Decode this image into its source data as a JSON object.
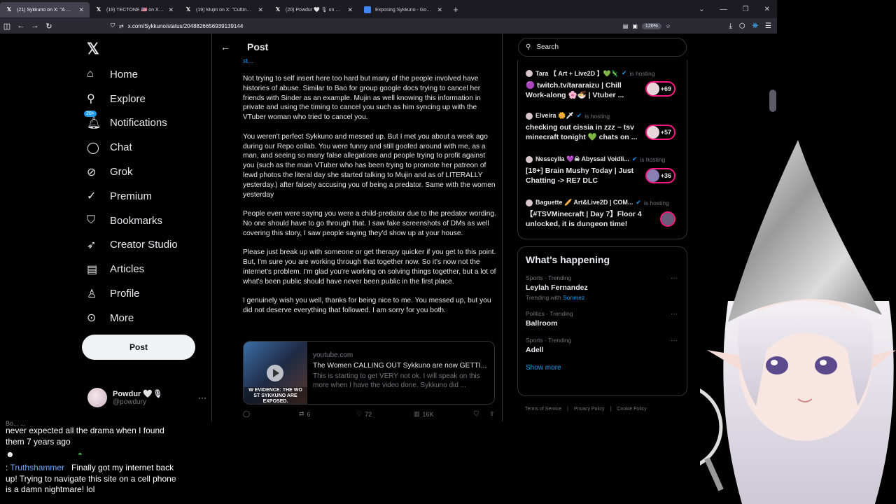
{
  "browser": {
    "tabs": [
      {
        "title": "(21) Sykkuno on X: \"A message",
        "icon": "x-logo-icon",
        "active": true
      },
      {
        "title": "(19) TECTONE 🇺🇸 on X: \"Cutting",
        "icon": "x-logo-icon"
      },
      {
        "title": "(19) Mujin on X: \"Cutting all tie",
        "icon": "x-logo-icon"
      },
      {
        "title": "(20) Powdur 🤍 🎙 on X: \"Bao,",
        "icon": "x-logo-icon"
      },
      {
        "title": "Exposing Sykkuno - Google Do",
        "icon": "google-docs-icon"
      }
    ],
    "url": "x.com/Sykkuno/status/2048826656939139144",
    "zoom": "120%"
  },
  "sidebar": {
    "items": [
      {
        "label": "Home",
        "icon": "home-icon"
      },
      {
        "label": "Explore",
        "icon": "search-icon"
      },
      {
        "label": "Notifications",
        "icon": "bell-icon",
        "badge": "20+"
      },
      {
        "label": "Chat",
        "icon": "chat-bubble-icon"
      },
      {
        "label": "Grok",
        "icon": "grok-icon"
      },
      {
        "label": "Premium",
        "icon": "premium-check-icon"
      },
      {
        "label": "Bookmarks",
        "icon": "bookmark-icon"
      },
      {
        "label": "Creator Studio",
        "icon": "rocket-icon"
      },
      {
        "label": "Articles",
        "icon": "articles-icon"
      },
      {
        "label": "Profile",
        "icon": "person-icon"
      },
      {
        "label": "More",
        "icon": "more-circle-icon"
      }
    ],
    "post_label": "Post",
    "profile": {
      "name": "Powdur 🤍🎙",
      "handle": "@powdury"
    }
  },
  "main": {
    "header_title": "Post",
    "cut_line": "st...",
    "paragraphs": [
      "Not trying to self insert here too hard but many of the people involved have histories of abuse. Similar to Bao for group google docs trying to cancel her friends with Sinder as an example. Mujin as well knowing this information in private and using the timing to cancel you such as him syncing up with the VTuber woman who tried to cancel you.",
      "You weren't perfect Sykkuno and messed up. But I met you about a week ago during our Repo collab. You were funny and still goofed around with me, as a man, and seeing so many false allegations and people trying to profit against you (such as the main VTuber who has been trying to promote her patreon of lewd photos the literal day she started talking to Mujin and as of LITERALLY yesterday.) after falsely accusing you of being a predator. Same with the women yesterday",
      "People even were saying you were a child-predator due to the predator wording. No one should have to go through that. I saw fake screenshots of DMs as well covering this story, I saw people saying they'd show up at your house.",
      "Please just break up with someone or get therapy quicker if you get to this point. But, I'm sure you are working through that together now. So it's now not the internet's problem. I'm glad you're working on solving things together, but a lot of what's been public should have never been public in the first place.",
      "I genuinely wish you well, thanks for being nice to me. You messed up, but you did not deserve everything that followed. I am sorry for you both."
    ],
    "card": {
      "domain": "youtube.com",
      "title": "The Women CALLING OUT Sykkuno are now GETTI...",
      "description": "This is starting to get VERY not ok. I will speak on this more when I have the video done. Sykkuno did ...",
      "thumb_caption": "W EVIDENCE: THE WO ST SYKKUNO ARE EXPOSED."
    },
    "actions": {
      "retweets": "6",
      "likes": "72",
      "views": "16K"
    }
  },
  "right": {
    "search_placeholder": "Search",
    "hosting_label": "is hosting",
    "live": [
      {
        "name": "Tara 【 Art + Live2D 】💚🦎",
        "title": "🟣 twitch.tv/tararaizu | Chill Work-along 🌸🍜 | Vtuber ...",
        "count": "+69"
      },
      {
        "name": "Elveira 🌼🗡",
        "title": "checking out cissia in zzz ~ tsv minecraft tonight 💚 chats on ...",
        "count": "+57"
      },
      {
        "name": "Nesscylla 💜☠ Abyssal Voidli...",
        "title": "[18+] Brain Mushy Today | Just Chatting -> RE7 DLC",
        "count": "+36"
      },
      {
        "name": "Baguette 🥖 Art&Live2D | COM...",
        "title": "【#TSVMinecraft | Day 7】Floor 4 unlocked, it is dungeon time!",
        "count": ""
      }
    ],
    "happening": {
      "title": "What's happening",
      "trends": [
        {
          "category": "Sports · Trending",
          "name": "Leylah Fernandez",
          "with_label": "Trending with",
          "with_link": "Sonmez"
        },
        {
          "category": "Politics · Trending",
          "name": "Ballroom"
        },
        {
          "category": "Sports · Trending",
          "name": "Adell"
        }
      ],
      "show_more": "Show more"
    },
    "footer": [
      "Terms of Service",
      "Privacy Policy",
      "Cookie Policy"
    ]
  },
  "chat": {
    "cut_line": "Bo... ...",
    "msg1": "never expected all the drama when I found them 7 years ago",
    "user2": "Truthshammer",
    "msg2": "Finally got my internet back up! Trying to navigate this site on a cell phone is a damn nightmare! lol"
  }
}
